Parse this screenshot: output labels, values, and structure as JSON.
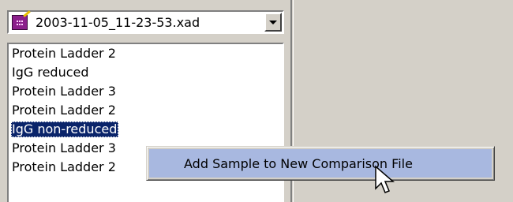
{
  "file_selector": {
    "file_icon": "sample-file-icon",
    "value": "2003-11-05_11-23-53.xad",
    "dropdown_icon": "chevron-down-icon"
  },
  "sample_list": {
    "items": [
      {
        "label": "Protein Ladder 2",
        "selected": false
      },
      {
        "label": "IgG reduced",
        "selected": false
      },
      {
        "label": "Protein Ladder 3",
        "selected": false
      },
      {
        "label": "Protein Ladder 2",
        "selected": false
      },
      {
        "label": "IgG non-reduced",
        "selected": true
      },
      {
        "label": "Protein Ladder 3",
        "selected": false
      },
      {
        "label": "Protein Ladder 2",
        "selected": false
      }
    ]
  },
  "context_menu": {
    "items": [
      {
        "label": "Add Sample to New Comparison File",
        "highlighted": true
      }
    ]
  },
  "cursor": {
    "icon": "mouse-pointer-icon"
  },
  "colors": {
    "window_bg": "#d4d0c8",
    "selection_bg": "#0a246a",
    "menu_highlight": "#a8b8e0"
  }
}
